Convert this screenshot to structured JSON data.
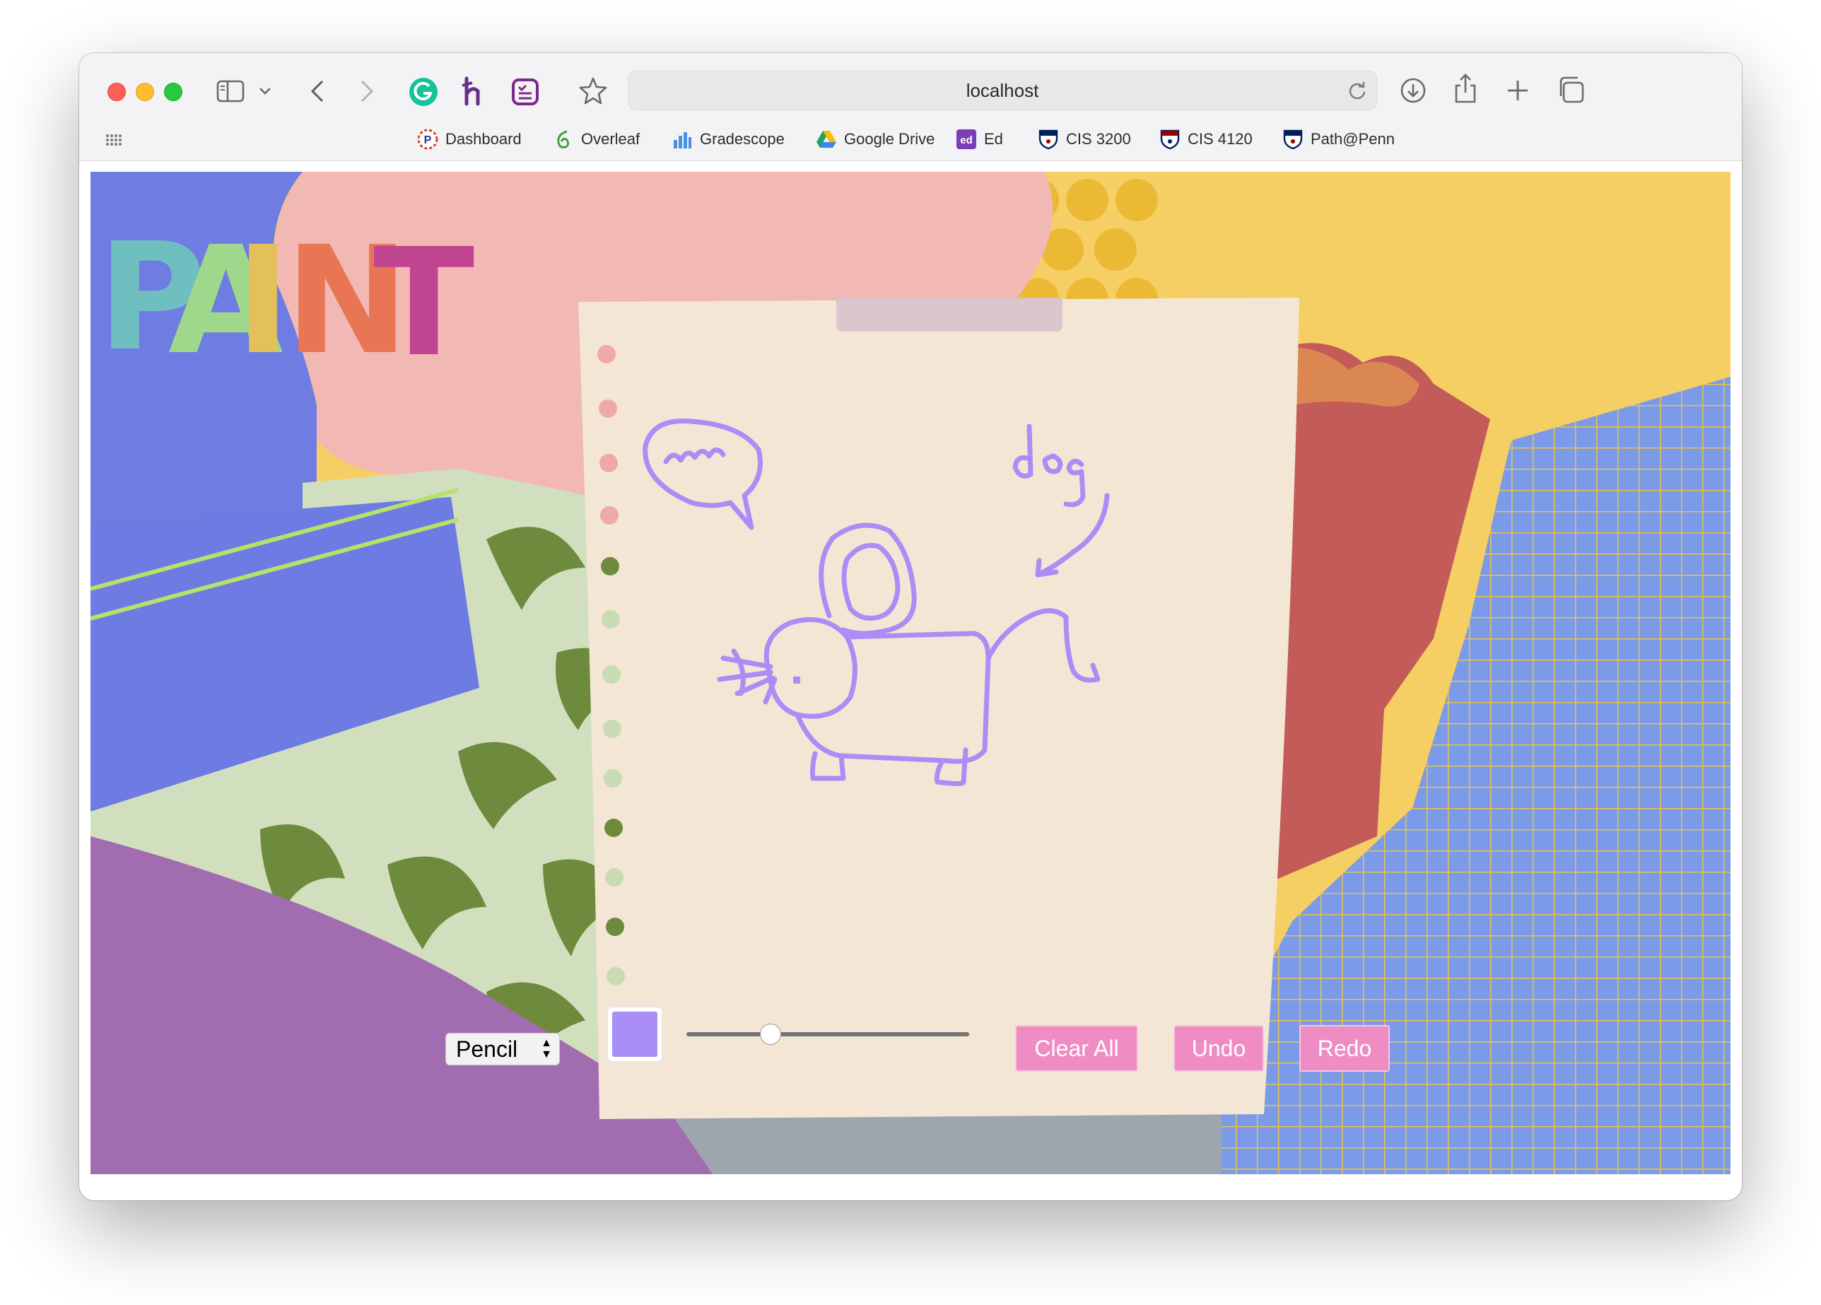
{
  "browser": {
    "address": "localhost",
    "bookmarks": [
      {
        "label": "Dashboard",
        "icon": "canvas-icon"
      },
      {
        "label": "Overleaf",
        "icon": "overleaf-icon"
      },
      {
        "label": "Gradescope",
        "icon": "gradescope-icon"
      },
      {
        "label": "Google Drive",
        "icon": "google-drive-icon"
      },
      {
        "label": "Ed",
        "icon": "ed-icon"
      },
      {
        "label": "CIS 3200",
        "icon": "penn-shield-icon"
      },
      {
        "label": "CIS 4120",
        "icon": "penn-shield-icon"
      },
      {
        "label": "Path@Penn",
        "icon": "penn-shield-icon"
      }
    ]
  },
  "app": {
    "logo_text": "PAINT",
    "logo_colors": [
      "#6fbfc0",
      "#9fd88a",
      "#e3c05a",
      "#e87655",
      "#c0448f"
    ],
    "tool_select": {
      "selected": "Pencil",
      "options": [
        "Pencil"
      ]
    },
    "stroke_color": "#a98ef5",
    "brush_size_fraction": 0.28,
    "buttons": {
      "clear": "Clear All",
      "undo": "Undo",
      "redo": "Redo"
    },
    "button_color": "#f08cc4",
    "drawing": {
      "speech_text": "meow",
      "caption_text": "dog",
      "subject": "mouse-shaped animal labeled dog"
    }
  }
}
